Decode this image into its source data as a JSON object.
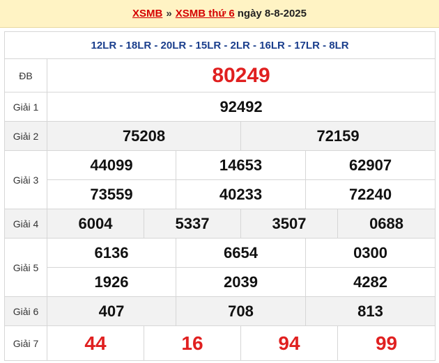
{
  "header": {
    "link1": "XSMB",
    "separator": "»",
    "link2": "XSMB thứ 6",
    "date_text": "ngày 8-8-2025"
  },
  "codes": "12LR - 18LR - 20LR - 15LR - 2LR - 16LR - 17LR - 8LR",
  "prizes": {
    "db": {
      "label": "ĐB",
      "numbers": [
        "80249"
      ]
    },
    "g1": {
      "label": "Giải 1",
      "numbers": [
        "92492"
      ]
    },
    "g2": {
      "label": "Giải 2",
      "numbers": [
        "75208",
        "72159"
      ]
    },
    "g3": {
      "label": "Giải 3",
      "numbers": [
        "44099",
        "14653",
        "62907",
        "73559",
        "40233",
        "72240"
      ]
    },
    "g4": {
      "label": "Giải 4",
      "numbers": [
        "6004",
        "5337",
        "3507",
        "0688"
      ]
    },
    "g5": {
      "label": "Giải 5",
      "numbers": [
        "6136",
        "6654",
        "0300",
        "1926",
        "2039",
        "4282"
      ]
    },
    "g6": {
      "label": "Giải 6",
      "numbers": [
        "407",
        "708",
        "813"
      ]
    },
    "g7": {
      "label": "Giải 7",
      "numbers": [
        "44",
        "16",
        "94",
        "99"
      ]
    }
  },
  "colors": {
    "accent_red": "#e02020",
    "code_blue": "#1a3e8c",
    "header_bg": "#fff3c4"
  }
}
